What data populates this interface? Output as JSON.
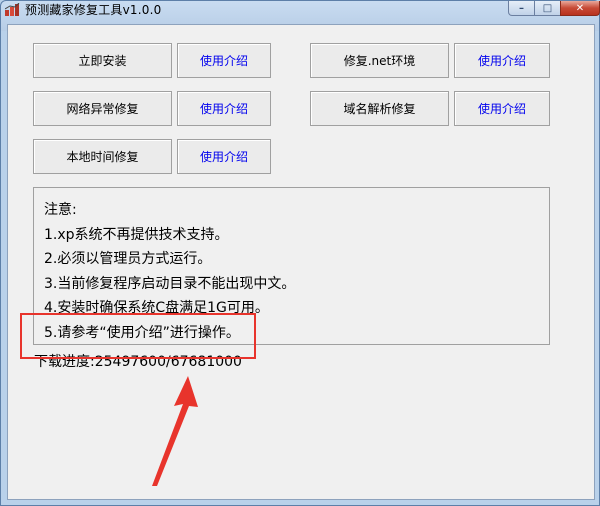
{
  "window": {
    "title": "预测藏家修复工具v1.0.0",
    "controls": {
      "minimize": "–",
      "maximize": "□",
      "close": "✕"
    }
  },
  "buttons": {
    "install": "立即安装",
    "install_help": "使用介绍",
    "net_fix": "修复.net环境",
    "net_fix_help": "使用介绍",
    "network_fix": "网络异常修复",
    "network_fix_help": "使用介绍",
    "dns_fix": "域名解析修复",
    "dns_fix_help": "使用介绍",
    "time_fix": "本地时间修复",
    "time_fix_help": "使用介绍"
  },
  "notice": {
    "heading": "注意:",
    "lines": [
      "1.xp系统不再提供技术支持。",
      "2.必须以管理员方式运行。",
      "3.当前修复程序启动目录不能出现中文。",
      "4.安装时确保系统C盘满足1G可用。",
      "5.请参考“使用介绍”进行操作。"
    ]
  },
  "progress": {
    "label": "下载进度:25497600/67681000",
    "downloaded_bytes": 25497600,
    "total_bytes": 67681000
  },
  "annotation_color": "#e8342c"
}
